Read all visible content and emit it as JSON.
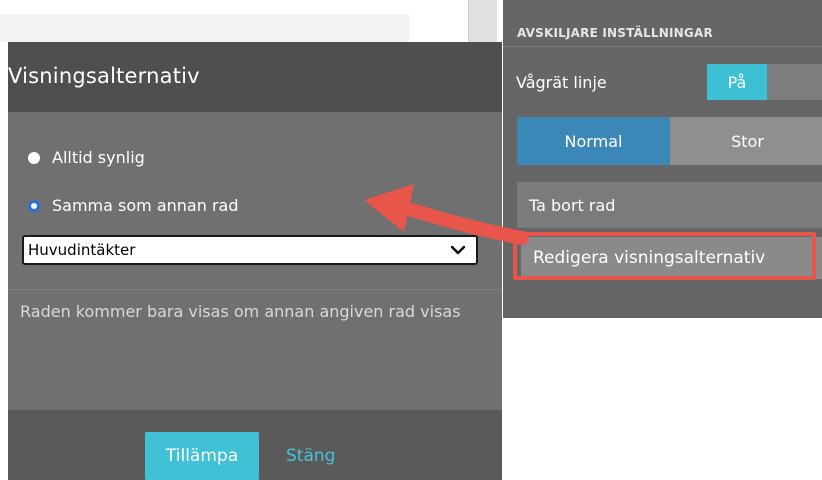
{
  "settings_panel": {
    "header": "AVSKILJARE INSTÄLLNINGAR",
    "horizontal_line": {
      "label": "Vågrät linje",
      "toggle_on": "På"
    },
    "size": {
      "normal": "Normal",
      "large": "Stor"
    },
    "delete_row": "Ta bort rad",
    "edit_display": "Redigera visningsalternativ"
  },
  "popover": {
    "title": "Visningsalternativ",
    "options": [
      {
        "label": "Alltid synlig",
        "selected": false
      },
      {
        "label": "Samma som annan rad",
        "selected": true
      }
    ],
    "dropdown_value": "Huvudintäkter",
    "help_text": "Raden kommer bara visas om annan angiven rad visas",
    "apply": "Tillämpa",
    "close": "Stäng"
  },
  "colors": {
    "accent": "#40c1d6",
    "selected_blue": "#3b87b8",
    "annotation_red": "#e8554a"
  },
  "icons": {
    "dropdown": "chevron-down-icon",
    "annotation": "arrow-icon"
  }
}
